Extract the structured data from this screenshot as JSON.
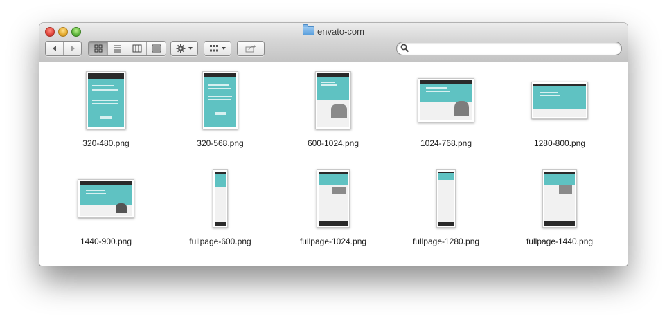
{
  "window": {
    "title": "envato-com"
  },
  "toolbar": {
    "back_icon": "back-arrow-icon",
    "forward_icon": "forward-arrow-icon",
    "views": [
      "icon-view-icon",
      "list-view-icon",
      "column-view-icon",
      "coverflow-view-icon"
    ],
    "active_view": 0,
    "action_icon": "gear-icon",
    "arrange_icon": "arrange-icon",
    "share_icon": "share-icon",
    "search_placeholder": ""
  },
  "files": [
    {
      "name": "320-480.png"
    },
    {
      "name": "320-568.png"
    },
    {
      "name": "600-1024.png"
    },
    {
      "name": "1024-768.png"
    },
    {
      "name": "1280-800.png"
    },
    {
      "name": "1440-900.png"
    },
    {
      "name": "fullpage-600.png"
    },
    {
      "name": "fullpage-1024.png"
    },
    {
      "name": "fullpage-1280.png"
    },
    {
      "name": "fullpage-1440.png"
    }
  ],
  "colors": {
    "thumb_teal": "#5fc2c2",
    "thumb_dark": "#2a2a2a"
  }
}
